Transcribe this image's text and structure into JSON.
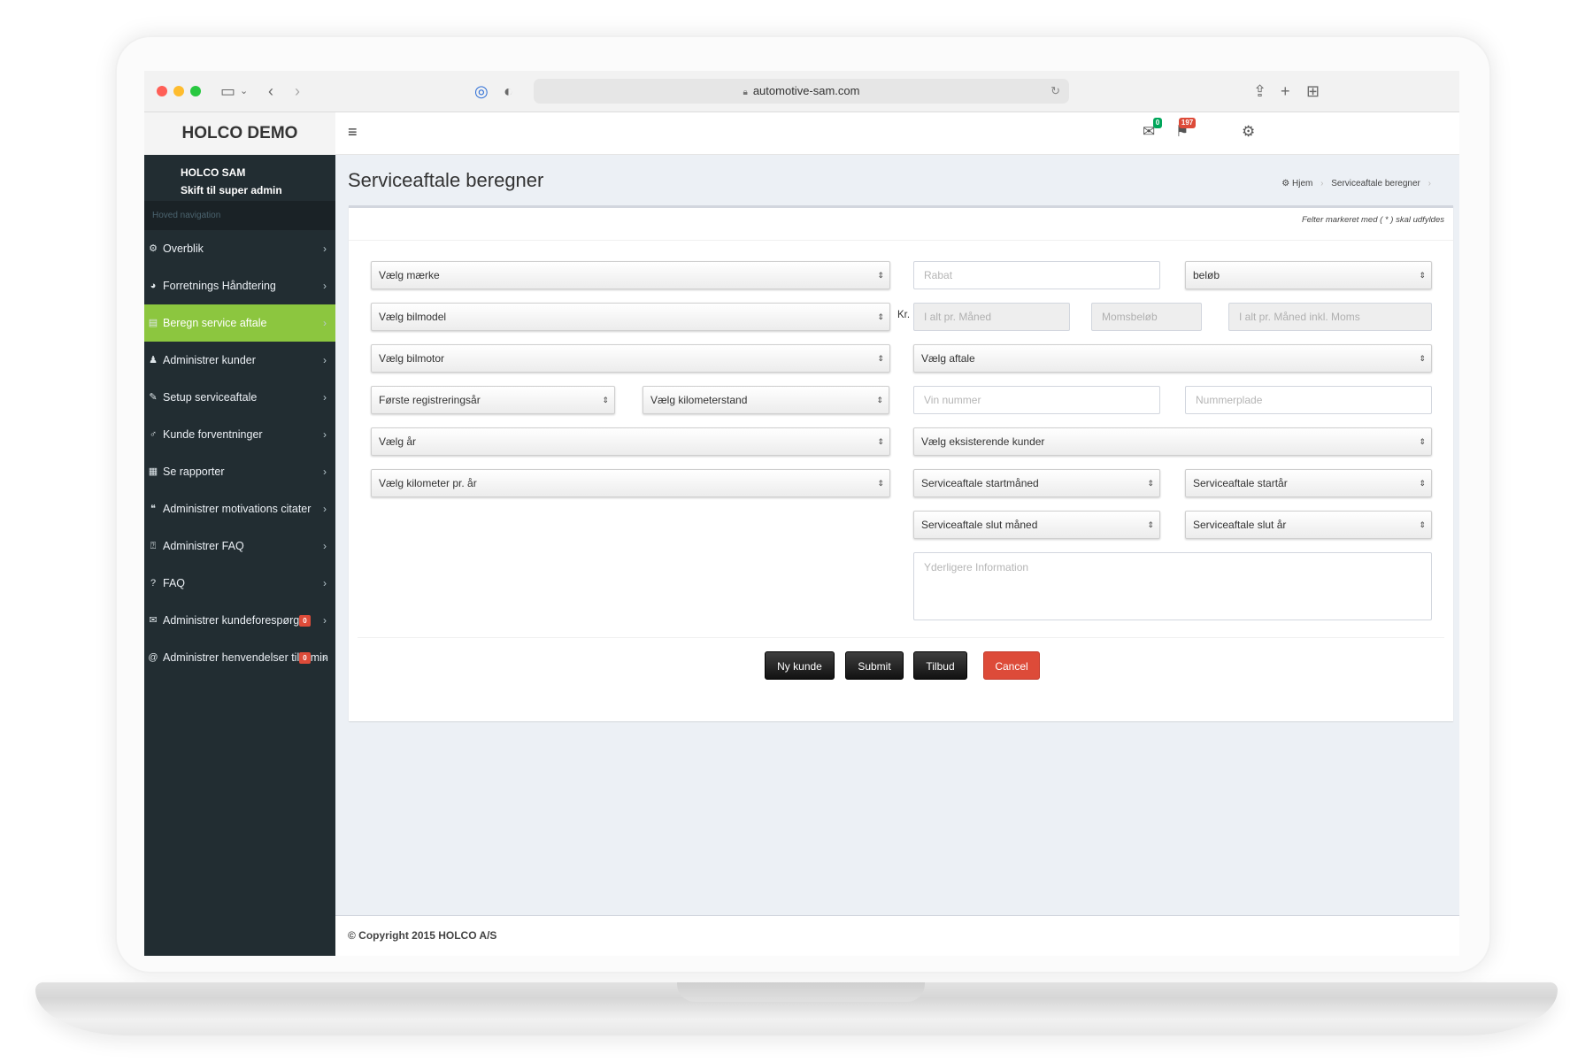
{
  "browser": {
    "url": "automotive-sam.com"
  },
  "header": {
    "logo": "HOLCO DEMO",
    "mail_badge": "0",
    "flag_badge": "197"
  },
  "sidebar": {
    "user_name": "HOLCO SAM",
    "switch_link": "Skift til super admin",
    "nav_header": "Hoved navigation",
    "items": [
      {
        "label": "Overblik",
        "icon": "dashboard-icon",
        "glyph": "⚙"
      },
      {
        "label": "Forretnings Håndtering",
        "icon": "pie-chart-icon",
        "glyph": "◕"
      },
      {
        "label": "Beregn service aftale",
        "icon": "document-icon",
        "glyph": "▤",
        "active": true
      },
      {
        "label": "Administrer kunder",
        "icon": "user-icon",
        "glyph": "♟"
      },
      {
        "label": "Setup serviceaftale",
        "icon": "wrench-icon",
        "glyph": "✎"
      },
      {
        "label": "Kunde forventninger",
        "icon": "person-icon",
        "glyph": "♂"
      },
      {
        "label": "Se rapporter",
        "icon": "table-icon",
        "glyph": "▦"
      },
      {
        "label": "Administrer motivations citater",
        "icon": "quote-icon",
        "glyph": "❝"
      },
      {
        "label": "Administrer FAQ",
        "icon": "question-box-icon",
        "glyph": "⍰"
      },
      {
        "label": "FAQ",
        "icon": "question-icon",
        "glyph": "?"
      },
      {
        "label": "Administrer kundeforespørg",
        "icon": "envelope-icon",
        "glyph": "✉",
        "badge": "0"
      },
      {
        "label": "Administrer henvendelser til",
        "icon": "at-icon",
        "glyph": "@",
        "badge": "0",
        "tail": "min"
      }
    ]
  },
  "page": {
    "title": "Serviceaftale beregner",
    "breadcrumb": [
      "Hjem",
      "Serviceaftale beregner"
    ],
    "required_note": "Felter markeret med ( * ) skal udfyldes"
  },
  "form": {
    "brand": "Vælg mærke",
    "model": "Vælg bilmodel",
    "engine": "Vælg bilmotor",
    "first_reg_year": "Første registreringsår",
    "mileage": "Vælg kilometerstand",
    "year": "Vælg år",
    "km_per_year": "Vælg kilometer pr. år",
    "discount_placeholder": "Rabat",
    "amount_select": "beløb",
    "kr_label": "Kr.",
    "monthly_total_placeholder": "I alt pr. Måned",
    "vat_amount_placeholder": "Momsbeløb",
    "monthly_total_vat_placeholder": "I alt pr. Måned inkl. Moms",
    "agreement": "Vælg aftale",
    "vin_placeholder": "Vin nummer",
    "plate_placeholder": "Nummerplade",
    "existing_customers": "Vælg eksisterende kunder",
    "start_month": "Serviceaftale startmåned",
    "start_year": "Serviceaftale startår",
    "end_month": "Serviceaftale slut måned",
    "end_year": "Serviceaftale slut år",
    "additional_info_placeholder": "Yderligere Information"
  },
  "buttons": {
    "new_customer": "Ny kunde",
    "submit": "Submit",
    "quote": "Tilbud",
    "cancel": "Cancel"
  },
  "footer": {
    "copyright": "© Copyright 2015 HOLCO A/S"
  },
  "colors": {
    "sidebar_bg": "#222d32",
    "active_green": "#8cc63f",
    "danger_red": "#dd4b39",
    "content_bg": "#ecf0f5"
  }
}
